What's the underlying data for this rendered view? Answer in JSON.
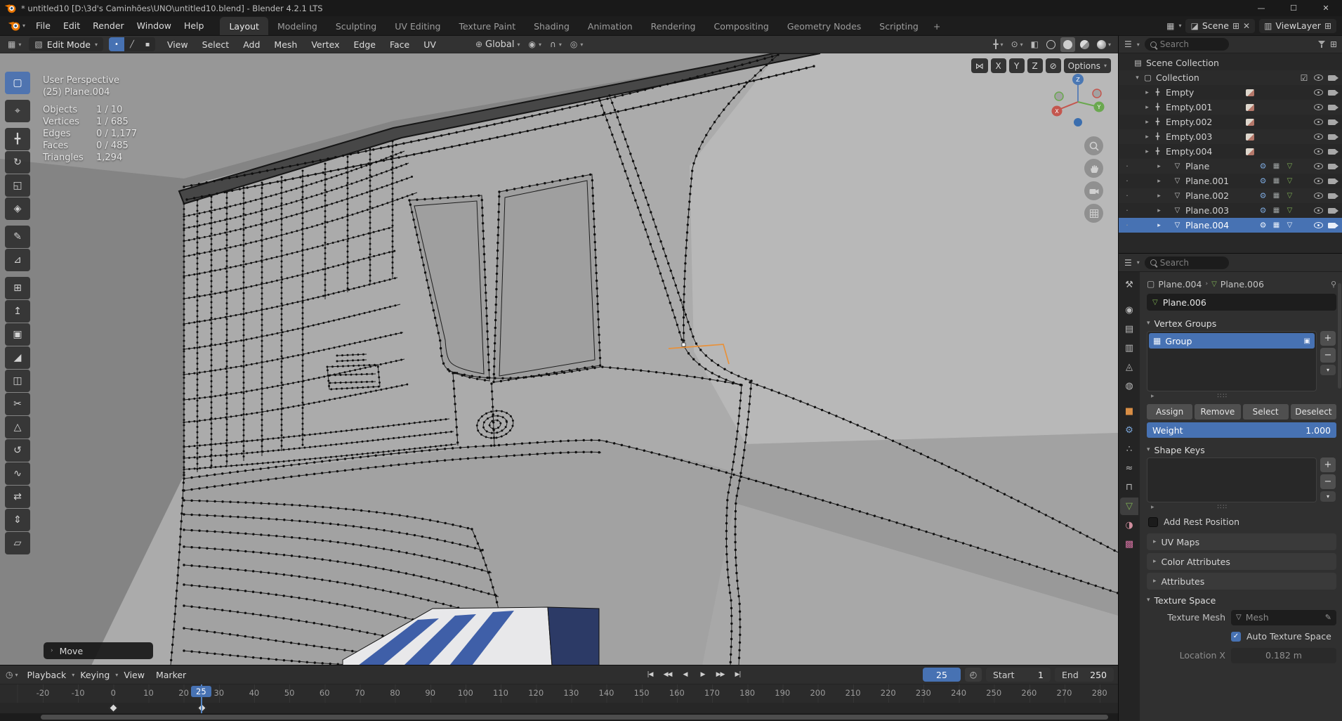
{
  "window": {
    "title": "* untitled10 [D:\\3d's Caminhões\\UNO\\untitled10.blend] - Blender 4.2.1 LTS"
  },
  "topbar": {
    "menus": [
      "File",
      "Edit",
      "Render",
      "Window",
      "Help"
    ],
    "tabs": [
      "Layout",
      "Modeling",
      "Sculpting",
      "UV Editing",
      "Texture Paint",
      "Shading",
      "Animation",
      "Rendering",
      "Compositing",
      "Geometry Nodes",
      "Scripting"
    ],
    "add_tab": "+",
    "scene": {
      "label": "Scene"
    },
    "viewlayer": {
      "label": "ViewLayer"
    }
  },
  "toolheader": {
    "mode": "Edit Mode",
    "menus": [
      "View",
      "Select",
      "Add",
      "Mesh",
      "Vertex",
      "Edge",
      "Face",
      "UV"
    ],
    "orientation": "Global",
    "mirror": [
      "X",
      "Y",
      "Z"
    ],
    "options": "Options"
  },
  "tools": [
    {
      "name": "select-box",
      "glyph": "▢"
    },
    {
      "name": "cursor",
      "glyph": "⌖"
    },
    {
      "name": "move",
      "glyph": "╋"
    },
    {
      "name": "rotate",
      "glyph": "↻"
    },
    {
      "name": "scale",
      "glyph": "◱"
    },
    {
      "name": "transform",
      "glyph": "◈"
    },
    {
      "name": "annotate",
      "glyph": "✎"
    },
    {
      "name": "measure",
      "glyph": "⊿"
    },
    {
      "name": "add-cube",
      "glyph": "⊞"
    },
    {
      "name": "extrude-region",
      "glyph": "↥"
    },
    {
      "name": "inset-faces",
      "glyph": "▣"
    },
    {
      "name": "bevel",
      "glyph": "◢"
    },
    {
      "name": "loop-cut",
      "glyph": "◫"
    },
    {
      "name": "knife",
      "glyph": "✂"
    },
    {
      "name": "poly-build",
      "glyph": "△"
    },
    {
      "name": "spin",
      "glyph": "↺"
    },
    {
      "name": "smooth",
      "glyph": "∿"
    },
    {
      "name": "edge-slide",
      "glyph": "⇄"
    },
    {
      "name": "shrink-fatten",
      "glyph": "⇕"
    },
    {
      "name": "shear",
      "glyph": "▱"
    }
  ],
  "viewport": {
    "view_label": "User Perspective",
    "object_label": "(25) Plane.004",
    "stats": [
      {
        "label": "Objects",
        "value": "1 / 10"
      },
      {
        "label": "Vertices",
        "value": "1 / 685"
      },
      {
        "label": "Edges",
        "value": "0 / 1,177"
      },
      {
        "label": "Faces",
        "value": "0 / 485"
      },
      {
        "label": "Triangles",
        "value": "1,294"
      }
    ],
    "operator": "Move",
    "gizmo": {
      "x": "X",
      "y": "Y",
      "z": "Z"
    }
  },
  "timeline": {
    "menus": [
      "Playback",
      "Keying",
      "View",
      "Marker"
    ],
    "frame": "25",
    "playhead": "25",
    "start_label": "Start",
    "start": "1",
    "end_label": "End",
    "end": "250",
    "ticks": [
      "-20",
      "-10",
      "0",
      "10",
      "20",
      "30",
      "40",
      "50",
      "60",
      "70",
      "80",
      "90",
      "100",
      "110",
      "120",
      "130",
      "140",
      "150",
      "160",
      "170",
      "180",
      "190",
      "200",
      "210",
      "220",
      "230",
      "240",
      "250",
      "260",
      "270",
      "280"
    ]
  },
  "outliner": {
    "search_placeholder": "Search",
    "rows": [
      {
        "label": "Scene Collection"
      },
      {
        "label": "Collection"
      },
      {
        "label": "Empty"
      },
      {
        "label": "Empty.001"
      },
      {
        "label": "Empty.002"
      },
      {
        "label": "Empty.003"
      },
      {
        "label": "Empty.004"
      },
      {
        "label": "Plane"
      },
      {
        "label": "Plane.001"
      },
      {
        "label": "Plane.002"
      },
      {
        "label": "Plane.003"
      },
      {
        "label": "Plane.004"
      }
    ]
  },
  "properties": {
    "search_placeholder": "Search",
    "breadcrumb": {
      "object": "Plane.004",
      "data": "Plane.006"
    },
    "name_field": "Plane.006",
    "vertex_groups": {
      "title": "Vertex Groups",
      "group": "Group",
      "buttons": [
        "Assign",
        "Remove",
        "Select",
        "Deselect"
      ],
      "weight_label": "Weight",
      "weight_value": "1.000"
    },
    "shape_keys": {
      "title": "Shape Keys",
      "add_rest": "Add Rest Position"
    },
    "collapsed": [
      "UV Maps",
      "Color Attributes",
      "Attributes"
    ],
    "texture_space": {
      "title": "Texture Space",
      "mesh_label": "Texture Mesh",
      "mesh_value": "Mesh",
      "auto_label": "Auto Texture Space",
      "location_label": "Location X",
      "location_value": "0.182 m"
    }
  },
  "colors": {
    "accent": "#4772b3",
    "select_orange": "#e8913a"
  }
}
